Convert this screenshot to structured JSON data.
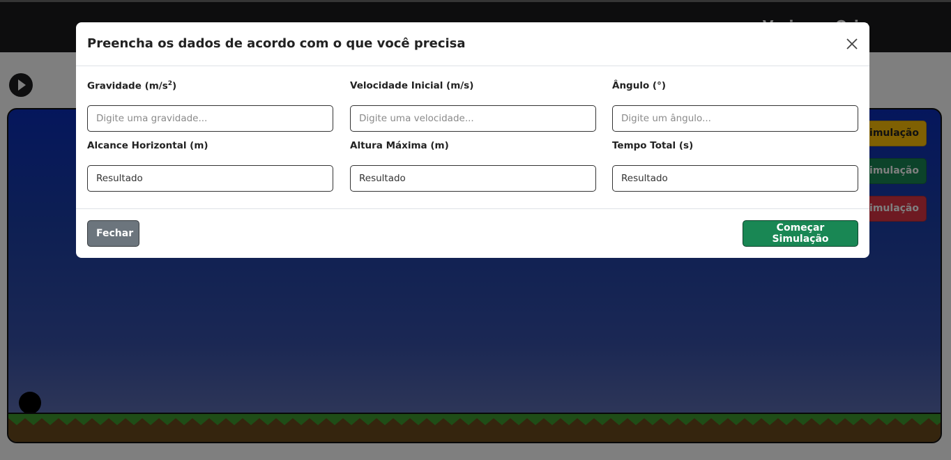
{
  "page": {
    "header_title": "Variacao Orig",
    "side_buttons": {
      "yellow_label": "Simulação",
      "green_label": "Simulação",
      "red_label": "Simulação"
    }
  },
  "modal": {
    "title": "Preencha os dados de acordo com o que você precisa",
    "fields": {
      "gravity": {
        "label": "Gravidade (m/s",
        "label_sup": "2",
        "label_end": ")",
        "placeholder": "Digite uma gravidade...",
        "value": ""
      },
      "velocity": {
        "label": "Velocidade Inicial (m/s)",
        "placeholder": "Digite uma velocidade...",
        "value": ""
      },
      "angle": {
        "label": "Ângulo (°)",
        "placeholder": "Digite um ângulo...",
        "value": ""
      },
      "range": {
        "label": "Alcance Horizontal (m)",
        "value": "Resultado"
      },
      "max_height": {
        "label": "Altura Máxima (m)",
        "value": "Resultado"
      },
      "total_time": {
        "label": "Tempo Total (s)",
        "value": "Resultado"
      }
    },
    "buttons": {
      "close_label": "Fechar",
      "start_label": "Começar Simulação"
    }
  },
  "colors": {
    "accent_green": "#198754",
    "secondary_gray": "#6c757d",
    "warning_yellow": "#ffc107",
    "danger_red": "#dc3545"
  },
  "icons": [
    "play-icon",
    "close-icon"
  ]
}
